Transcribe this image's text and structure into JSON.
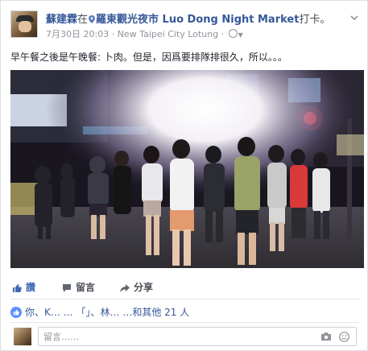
{
  "post": {
    "author": "蘇建霖",
    "at_word": "在",
    "place": "羅東觀光夜市 Luo Dong Night Market",
    "checkin_suffix": "打卡。",
    "date": "7月30日 20:03",
    "dot": "·",
    "location": "New Taipei City Lotung",
    "dot2": "·",
    "text": "早午餐之後是午晚餐: 卜肉。但是，因爲要排隊排很久，所以。。。",
    "more_icon": "chevron-down-icon"
  },
  "actions": {
    "like": "讚",
    "comment": "留言",
    "share": "分享"
  },
  "likes": {
    "text": "你、K… … 「」、林… …和其他 21 人"
  },
  "comment_input": {
    "placeholder": "留言……"
  },
  "colors": {
    "link": "#365899",
    "like_blue": "#4267b2",
    "meta_gray": "#90949c"
  }
}
